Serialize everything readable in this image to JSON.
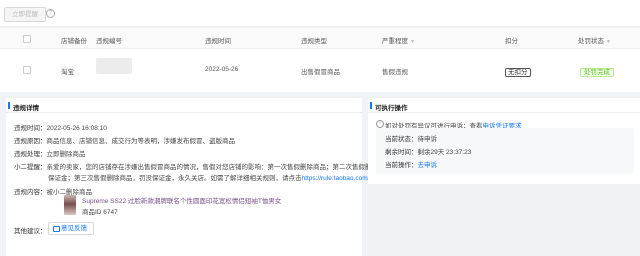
{
  "toolbar": {
    "remind_label": "立即提醒",
    "help_icon": "question-circle-icon"
  },
  "table": {
    "headers": [
      "店铺备份",
      "违规编号",
      "违规时间",
      "违规类型",
      "严重程度",
      "扣分",
      "处罚状态"
    ],
    "row": {
      "shop": "淘宝",
      "violation_id": "",
      "time": "2022-05-26",
      "type": "出售假冒商品",
      "severity": "售假违规",
      "deduct": "无扣分",
      "status": "处罚完成"
    }
  },
  "details": {
    "title": "违规详情",
    "time_label": "违规时间：",
    "time_value": "2022-05-26 16:08:10",
    "reason_label": "违规原因：",
    "reason_value": "商品信息、店铺信息、成交行为等表明，涉嫌发布假冒、盗版商品",
    "handling_label": "违规处理：",
    "handling_value": "立即删除商品",
    "tip_label": "小二提醒：",
    "tip_line1": "亲爱的卖家，您的店铺存在涉嫌出售假冒商品的情况，售假对您店铺的影响：第一次售假删除商品；第二次售假删除商品，罚没",
    "tip_line2_prefix": "保证金；第三次售假删除商品，罚没保证金，永久关店。如需了解详细相关规则，请点击",
    "tip_link": "https://rule.taobao.com/detail-506.htm",
    "goods_label": "违规内容：",
    "goods_action": "被小二删除商品",
    "goods_title": "Supreme SS22 过脸新款潮牌联名个性圆面印花宽松情侣短袖T恤男女",
    "goods_id": "商品ID 6747",
    "other_label": "其他建议：",
    "feedback_label": "意见反馈"
  },
  "actions": {
    "title": "可执行操作",
    "notice": "如对处罚有异议可进行申诉；查看",
    "notice_link": "申诉凭证要求",
    "status_label": "当前状态：",
    "status_value": "待申诉",
    "left_label": "剩余时间：",
    "left_value": "剩余29天 23:37:23",
    "op_label": "当前操作：",
    "op_link": "去申诉"
  }
}
